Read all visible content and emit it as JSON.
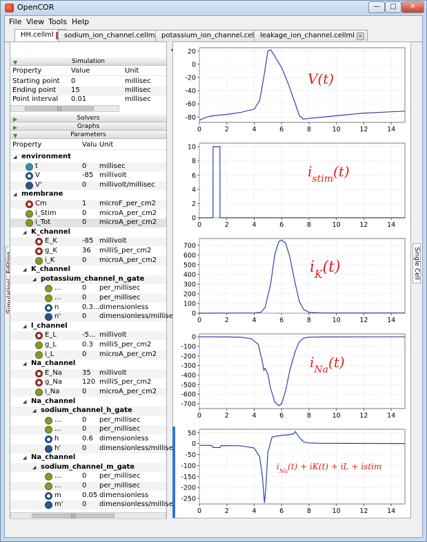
{
  "window": {
    "title": "OpenCOR"
  },
  "menu": [
    "File",
    "View",
    "Tools",
    "Help"
  ],
  "tabs": [
    {
      "label": "HH.cellml",
      "active": true
    },
    {
      "label": "sodium_ion_channel.cellml*",
      "active": false
    },
    {
      "label": "potassium_ion_channel.cellml",
      "active": false
    },
    {
      "label": "leakage_ion_channel.cellml",
      "active": false
    }
  ],
  "toolbar": {
    "delay_value": "0"
  },
  "side_tabs": {
    "editing": "Editing",
    "simulation": "Simulation",
    "single_cell": "Single Cell"
  },
  "simulation": {
    "header": "Simulation",
    "columns": [
      "Property",
      "Value",
      "Unit"
    ],
    "rows": [
      {
        "property": "Starting point",
        "value": "0",
        "unit": "millisec"
      },
      {
        "property": "Ending point",
        "value": "15",
        "unit": "millisec"
      },
      {
        "property": "Point interval",
        "value": "0.01",
        "unit": "millisec"
      }
    ]
  },
  "solvers": {
    "header": "Solvers"
  },
  "graphs_section": {
    "header": "Graphs"
  },
  "parameters": {
    "header": "Parameters",
    "columns": [
      "Property",
      "Valu",
      "Unit"
    ],
    "rows": [
      {
        "kind": "group",
        "name": "environment",
        "indent": 0
      },
      {
        "kind": "item",
        "icon": "teal",
        "name": "t",
        "value": "0",
        "unit": "millisec",
        "indent": 1
      },
      {
        "kind": "item",
        "icon": "ring",
        "name": "V",
        "value": "-85",
        "unit": "millivolt",
        "indent": 1
      },
      {
        "kind": "item",
        "icon": "blue",
        "name": "V'",
        "value": "0",
        "unit": "millivolt/millisec",
        "indent": 1
      },
      {
        "kind": "group",
        "name": "membrane",
        "indent": 0
      },
      {
        "kind": "item",
        "icon": "red",
        "name": "Cm",
        "value": "1",
        "unit": "microF_per_cm2",
        "indent": 1
      },
      {
        "kind": "item",
        "icon": "olive",
        "name": "i_Stim",
        "value": "0",
        "unit": "microA_per_cm2",
        "indent": 1
      },
      {
        "kind": "item",
        "icon": "olive",
        "name": "i_Tot",
        "value": "0",
        "unit": "microA_per_cm2",
        "indent": 1,
        "selected": true
      },
      {
        "kind": "group",
        "name": "K_channel",
        "indent": 1
      },
      {
        "kind": "item",
        "icon": "red",
        "name": "E_K",
        "value": "-85",
        "unit": "millivolt",
        "indent": 2
      },
      {
        "kind": "item",
        "icon": "red",
        "name": "g_K",
        "value": "36",
        "unit": "milliS_per_cm2",
        "indent": 2
      },
      {
        "kind": "item",
        "icon": "olive",
        "name": "i_K",
        "value": "0",
        "unit": "microA_per_cm2",
        "indent": 2
      },
      {
        "kind": "group",
        "name": "K_channel",
        "indent": 1
      },
      {
        "kind": "group",
        "name": "potassium_channel_n_gate",
        "indent": 2
      },
      {
        "kind": "item",
        "icon": "olive",
        "name": "...",
        "value": "0",
        "unit": "per_millisec",
        "indent": 3
      },
      {
        "kind": "item",
        "icon": "olive",
        "name": "...",
        "value": "0",
        "unit": "per_millisec",
        "indent": 3
      },
      {
        "kind": "item",
        "icon": "ring",
        "name": "n",
        "value": "0.3...",
        "unit": "dimensionless",
        "indent": 3
      },
      {
        "kind": "item",
        "icon": "blue",
        "name": "n'",
        "value": "0",
        "unit": "dimensionless/millisec",
        "indent": 3
      },
      {
        "kind": "group",
        "name": "l_channel",
        "indent": 1
      },
      {
        "kind": "item",
        "icon": "red",
        "name": "E_L",
        "value": "-5...",
        "unit": "millivolt",
        "indent": 2
      },
      {
        "kind": "item",
        "icon": "olive",
        "name": "g_L",
        "value": "0.3",
        "unit": "milliS_per_cm2",
        "indent": 2
      },
      {
        "kind": "item",
        "icon": "olive",
        "name": "i_L",
        "value": "0",
        "unit": "microA_per_cm2",
        "indent": 2
      },
      {
        "kind": "group",
        "name": "Na_channel",
        "indent": 1
      },
      {
        "kind": "item",
        "icon": "red",
        "name": "E_Na",
        "value": "35",
        "unit": "millivolt",
        "indent": 2
      },
      {
        "kind": "item",
        "icon": "red",
        "name": "g_Na",
        "value": "120",
        "unit": "milliS_per_cm2",
        "indent": 2
      },
      {
        "kind": "item",
        "icon": "olive",
        "name": "i_Na",
        "value": "0",
        "unit": "microA_per_cm2",
        "indent": 2
      },
      {
        "kind": "group",
        "name": "Na_channel",
        "indent": 1
      },
      {
        "kind": "group",
        "name": "sodium_channel_h_gate",
        "indent": 2
      },
      {
        "kind": "item",
        "icon": "olive",
        "name": "...",
        "value": "0",
        "unit": "per_millisec",
        "indent": 3
      },
      {
        "kind": "item",
        "icon": "olive",
        "name": "...",
        "value": "0",
        "unit": "per_millisec",
        "indent": 3
      },
      {
        "kind": "item",
        "icon": "ring",
        "name": "h",
        "value": "0.6",
        "unit": "dimensionless",
        "indent": 3
      },
      {
        "kind": "item",
        "icon": "blue",
        "name": "h'",
        "value": "0",
        "unit": "dimensionless/millisec",
        "indent": 3
      },
      {
        "kind": "group",
        "name": "Na_channel",
        "indent": 1
      },
      {
        "kind": "group",
        "name": "sodium_channel_m_gate",
        "indent": 2
      },
      {
        "kind": "item",
        "icon": "olive",
        "name": "...",
        "value": "0",
        "unit": "per_millisec",
        "indent": 3
      },
      {
        "kind": "item",
        "icon": "olive",
        "name": "...",
        "value": "0",
        "unit": "per_millisec",
        "indent": 3
      },
      {
        "kind": "item",
        "icon": "ring",
        "name": "m",
        "value": "0.05",
        "unit": "dimensionless",
        "indent": 3
      },
      {
        "kind": "item",
        "icon": "blue",
        "name": "m'",
        "value": "0",
        "unit": "dimensionless/millisec",
        "indent": 3
      }
    ]
  },
  "colors": {
    "trace": "#2d3fa8",
    "annotation": "#e02020",
    "grid": "#d6d6d6"
  },
  "chart_data": [
    {
      "type": "line",
      "xlim": [
        0,
        15
      ],
      "ylim": [
        -88,
        25
      ],
      "xticks": [
        "0",
        "2",
        "4",
        "6",
        "8",
        "10",
        "12",
        "14"
      ],
      "yticks": [
        "20",
        "0",
        "-20",
        "-40",
        "-60",
        "-80"
      ],
      "annotation": "V(t)",
      "series": [
        {
          "x": [
            0,
            0.5,
            1,
            1.5,
            2,
            3,
            4,
            4.4,
            4.7,
            5,
            5.2,
            5.5,
            6,
            6.5,
            7,
            7.3,
            7.6,
            8,
            9,
            10,
            11,
            12,
            13,
            14,
            15
          ],
          "y": [
            -85,
            -80,
            -78,
            -77,
            -76,
            -73,
            -68,
            -55,
            -20,
            20,
            22,
            12,
            -5,
            -30,
            -60,
            -78,
            -83,
            -82,
            -80,
            -78,
            -76,
            -74,
            -73,
            -72,
            -71
          ]
        }
      ]
    },
    {
      "type": "line",
      "xlim": [
        0,
        15
      ],
      "ylim": [
        0,
        10.5
      ],
      "xticks": [
        "0",
        "2",
        "4",
        "6",
        "8",
        "10",
        "12",
        "14"
      ],
      "yticks": [
        "10",
        "8",
        "6",
        "4",
        "2",
        "0"
      ],
      "annotation": "i_stim(t)",
      "series": [
        {
          "x": [
            0,
            0.99,
            1,
            1.5,
            1.51,
            15
          ],
          "y": [
            0,
            0,
            10,
            10,
            0,
            0
          ]
        }
      ]
    },
    {
      "type": "line",
      "xlim": [
        0,
        15
      ],
      "ylim": [
        0,
        770
      ],
      "xticks": [
        "0",
        "2",
        "4",
        "6",
        "8",
        "10",
        "12",
        "14"
      ],
      "yticks": [
        "700",
        "600",
        "500",
        "400",
        "300",
        "200",
        "100",
        "0"
      ],
      "annotation": "i_K(t)",
      "series": [
        {
          "x": [
            0,
            4,
            4.5,
            4.8,
            5.2,
            5.5,
            5.8,
            6,
            6.3,
            6.6,
            7,
            7.3,
            7.6,
            8,
            9,
            15
          ],
          "y": [
            0,
            2,
            10,
            60,
            300,
            600,
            740,
            755,
            720,
            580,
            300,
            120,
            40,
            8,
            2,
            2
          ]
        }
      ]
    },
    {
      "type": "line",
      "xlim": [
        0,
        15
      ],
      "ylim": [
        -750,
        30
      ],
      "xticks": [
        "0",
        "2",
        "4",
        "6",
        "8",
        "10",
        "12",
        "14"
      ],
      "yticks": [
        "0",
        "-100",
        "-200",
        "-300",
        "-400",
        "-500",
        "-600",
        "-700"
      ],
      "annotation": "i_Na(t)",
      "series": [
        {
          "x": [
            0,
            2,
            3,
            3.8,
            4.3,
            4.6,
            4.7,
            4.8,
            5,
            5.2,
            5.5,
            5.8,
            6,
            6.3,
            6.6,
            7,
            7.3,
            7.6,
            8,
            9,
            15
          ],
          "y": [
            0,
            -2,
            -5,
            -20,
            -80,
            -260,
            -350,
            -330,
            -390,
            -540,
            -680,
            -720,
            -700,
            -560,
            -350,
            -150,
            -50,
            -15,
            -5,
            -2,
            0
          ]
        }
      ]
    },
    {
      "type": "line",
      "xlim": [
        0,
        15
      ],
      "ylim": [
        -275,
        65
      ],
      "xticks": [
        "0",
        "2",
        "4",
        "6",
        "8",
        "10",
        "12",
        "14"
      ],
      "yticks": [
        "50",
        "0",
        "-50",
        "-100",
        "-150",
        "-200",
        "-250"
      ],
      "annotation": "i_Na(t) + i_K(t) + i_L + i_stim",
      "series": [
        {
          "x": [
            0,
            0.9,
            1,
            1.5,
            1.6,
            3,
            4,
            4.4,
            4.6,
            4.75,
            4.85,
            5,
            5.3,
            6,
            6.5,
            6.9,
            7,
            7.3,
            7.6,
            8,
            9,
            15
          ],
          "y": [
            -8,
            -9,
            -18,
            -18,
            -9,
            -10,
            -20,
            -60,
            -150,
            -270,
            -200,
            -40,
            30,
            38,
            40,
            45,
            55,
            28,
            8,
            3,
            1,
            0
          ]
        }
      ]
    }
  ]
}
